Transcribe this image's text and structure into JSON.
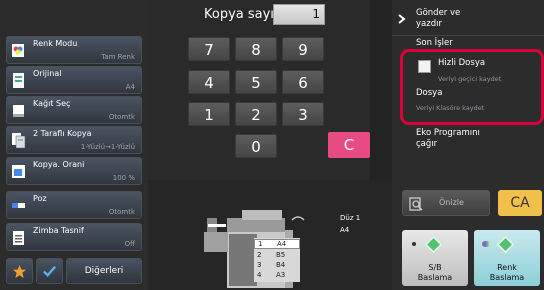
{
  "left_menu": [
    {
      "title": "Renk Modu",
      "value": "Tam Renk",
      "icon": "color-mode-icon"
    },
    {
      "title": "Orijinal",
      "value": "A4",
      "icon": "original-icon"
    },
    {
      "title": "Kağıt Seç",
      "value": "Otomtk",
      "icon": "paper-select-icon"
    },
    {
      "title": "2 Taraflı Kopya",
      "value": "1-Yüzlü→1-Yüzlü",
      "icon": "duplex-icon"
    },
    {
      "title": "Kopya. Orani",
      "value": "100 %",
      "icon": "copy-ratio-icon"
    },
    {
      "title": "Poz",
      "value": "Otomtk",
      "icon": "exposure-icon"
    },
    {
      "title": "Zimba Tasnif",
      "value": "Off",
      "icon": "staple-sort-icon"
    }
  ],
  "bottom_left": {
    "others_label": "Diğerleri"
  },
  "keypad": {
    "title": "Kopya sayısı",
    "count": "1",
    "keys": [
      "7",
      "8",
      "9",
      "4",
      "5",
      "6",
      "1",
      "2",
      "3",
      "0"
    ],
    "clear": "C"
  },
  "right_panel": {
    "send_and_print": "Gönder ve\nyazdır",
    "stored_jobs": "Son İşler",
    "quick_file": "Hizli Dosya",
    "quick_file_sub": "Veriyi geçici kaydet",
    "file": "Dosya",
    "file_sub": "Veriyi Klasöre kaydet",
    "eco_program": "Eko Programını\nçağır",
    "preview": "Önizle",
    "ca": "CA",
    "bw_start": "S/B\nBaslama",
    "color_start": "Renk\nBaslama"
  },
  "machine": {
    "output_label": "Düz 1",
    "output_size": "A4",
    "trays": [
      {
        "num": "1",
        "size": "A4"
      },
      {
        "num": "2",
        "size": "B5"
      },
      {
        "num": "3",
        "size": "B4"
      },
      {
        "num": "4",
        "size": "A3"
      }
    ]
  },
  "colors": {
    "highlight": "#d9003b",
    "clear_key": "#e84b84",
    "ca": "#f0c04a",
    "start_green": "#54c172"
  }
}
